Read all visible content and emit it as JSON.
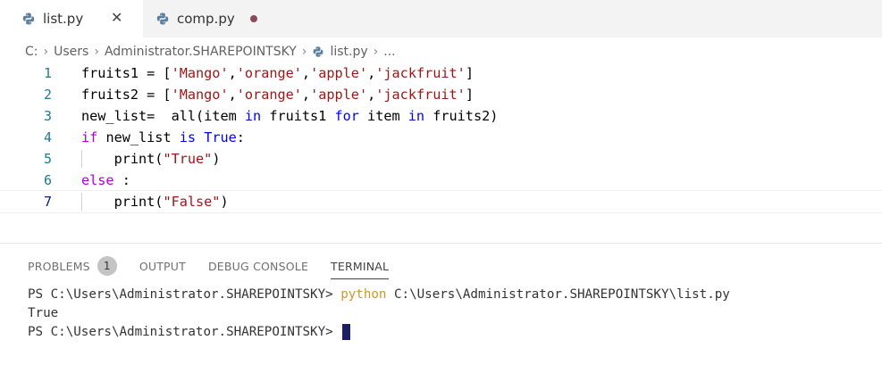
{
  "tabs": [
    {
      "label": "list.py",
      "active": true,
      "icon": "python-file-icon"
    },
    {
      "label": "comp.py",
      "active": false,
      "icon": "python-file-icon",
      "modified": true
    }
  ],
  "breadcrumb": {
    "parts": [
      "C:",
      "Users",
      "Administrator.SHAREPOINTSKY",
      "list.py",
      "..."
    ]
  },
  "editor": {
    "lines": [
      {
        "n": "1",
        "text": "fruits1 = ['Mango','orange','apple','jackfruit']"
      },
      {
        "n": "2",
        "text": "fruits2 = ['Mango','orange','apple','jackfruit']"
      },
      {
        "n": "3",
        "text": "new_list=  all(item in fruits1 for item in fruits2)"
      },
      {
        "n": "4",
        "text": "if new_list is True:"
      },
      {
        "n": "5",
        "text": "    print(\"True\")"
      },
      {
        "n": "6",
        "text": "else :"
      },
      {
        "n": "7",
        "text": "    print(\"False\")"
      }
    ],
    "current_line": "7"
  },
  "panel": {
    "tabs": [
      "PROBLEMS",
      "OUTPUT",
      "DEBUG CONSOLE",
      "TERMINAL"
    ],
    "problems_count": "1",
    "active_tab": "TERMINAL"
  },
  "terminal": {
    "prompt": "PS C:\\Users\\Administrator.SHAREPOINTSKY> ",
    "command": "python",
    "args": " C:\\Users\\Administrator.SHAREPOINTSKY\\list.py",
    "output": "True",
    "prompt2": "PS C:\\Users\\Administrator.SHAREPOINTSKY> "
  },
  "colors": {
    "keyword": "#0000ff",
    "string": "#a31515",
    "line_number": "#237893",
    "terminal_command": "#cd9731"
  }
}
